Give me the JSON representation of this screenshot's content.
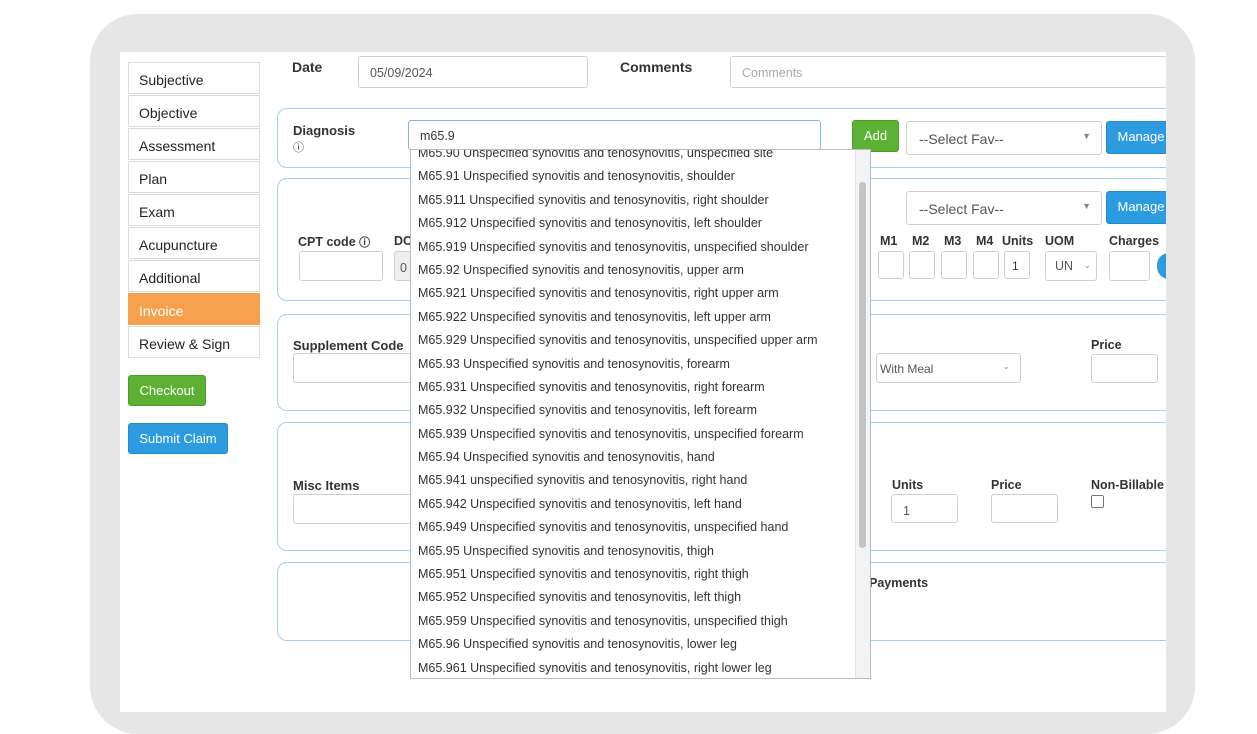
{
  "sidebar": {
    "items": [
      {
        "label": "Subjective"
      },
      {
        "label": "Objective"
      },
      {
        "label": "Assessment"
      },
      {
        "label": "Plan"
      },
      {
        "label": "Exam"
      },
      {
        "label": "Acupuncture"
      },
      {
        "label": "Additional"
      },
      {
        "label": "Invoice",
        "active": true
      },
      {
        "label": "Review & Sign"
      }
    ],
    "checkout_label": "Checkout",
    "submit_claim_label": "Submit Claim"
  },
  "header": {
    "date_label": "Date",
    "date_value": "05/09/2024",
    "comments_label": "Comments",
    "comments_placeholder": "Comments"
  },
  "diagnosis": {
    "label": "Diagnosis",
    "info_icon": "info-circle-icon",
    "input_value": "m65.9",
    "add_label": "Add",
    "fav_selected": "--Select Fav--",
    "manage_label": "Manage"
  },
  "cpt": {
    "label": "CPT code",
    "dx_label": "DC",
    "dx_value": "0",
    "fav_selected": "--Select Fav--",
    "manage_label": "Manage",
    "columns": [
      "M1",
      "M2",
      "M3",
      "M4",
      "Units",
      "UOM",
      "Charges"
    ],
    "units_value": "1",
    "uom_value": "UN"
  },
  "supplement": {
    "label": "Supplement Code",
    "meal_selected": "With Meal",
    "price_label": "Price"
  },
  "misc": {
    "label": "Misc Items",
    "units_label": "Units",
    "units_value": "1",
    "price_label": "Price",
    "non_billable_label": "Non-Billable"
  },
  "payments": {
    "label": "Payments"
  },
  "autocomplete": {
    "items": [
      "M65.90 Unspecified synovitis and tenosynovitis, unspecified site",
      "M65.91 Unspecified synovitis and tenosynovitis, shoulder",
      "M65.911 Unspecified synovitis and tenosynovitis, right shoulder",
      "M65.912 Unspecified synovitis and tenosynovitis, left shoulder",
      "M65.919 Unspecified synovitis and tenosynovitis, unspecified shoulder",
      "M65.92 Unspecified synovitis and tenosynovitis, upper arm",
      "M65.921 Unspecified synovitis and tenosynovitis, right upper arm",
      "M65.922 Unspecified synovitis and tenosynovitis, left upper arm",
      "M65.929 Unspecified synovitis and tenosynovitis, unspecified upper arm",
      "M65.93 Unspecified synovitis and tenosynovitis, forearm",
      "M65.931 Unspecified synovitis and tenosynovitis, right forearm",
      "M65.932 Unspecified synovitis and tenosynovitis, left forearm",
      "M65.939 Unspecified synovitis and tenosynovitis, unspecified forearm",
      "M65.94 Unspecified synovitis and tenosynovitis, hand",
      "M65.941 unspecified synovitis and tenosynovitis, right hand",
      "M65.942 Unspecified synovitis and tenosynovitis, left hand",
      "M65.949 Unspecified synovitis and tenosynovitis, unspecified hand",
      "M65.95 Unspecified synovitis and tenosynovitis, thigh",
      "M65.951 Unspecified synovitis and tenosynovitis, right thigh",
      "M65.952 Unspecified synovitis and tenosynovitis, left thigh",
      "M65.959 Unspecified synovitis and tenosynovitis, unspecified thigh",
      "M65.96 Unspecified synovitis and tenosynovitis, lower leg",
      "M65.961 Unspecified synovitis and tenosynovitis, right lower leg"
    ]
  },
  "colors": {
    "accent_orange": "#f5a04c",
    "green": "#5cb034",
    "blue": "#2d9be0",
    "section_border": "#9fd0f2"
  }
}
